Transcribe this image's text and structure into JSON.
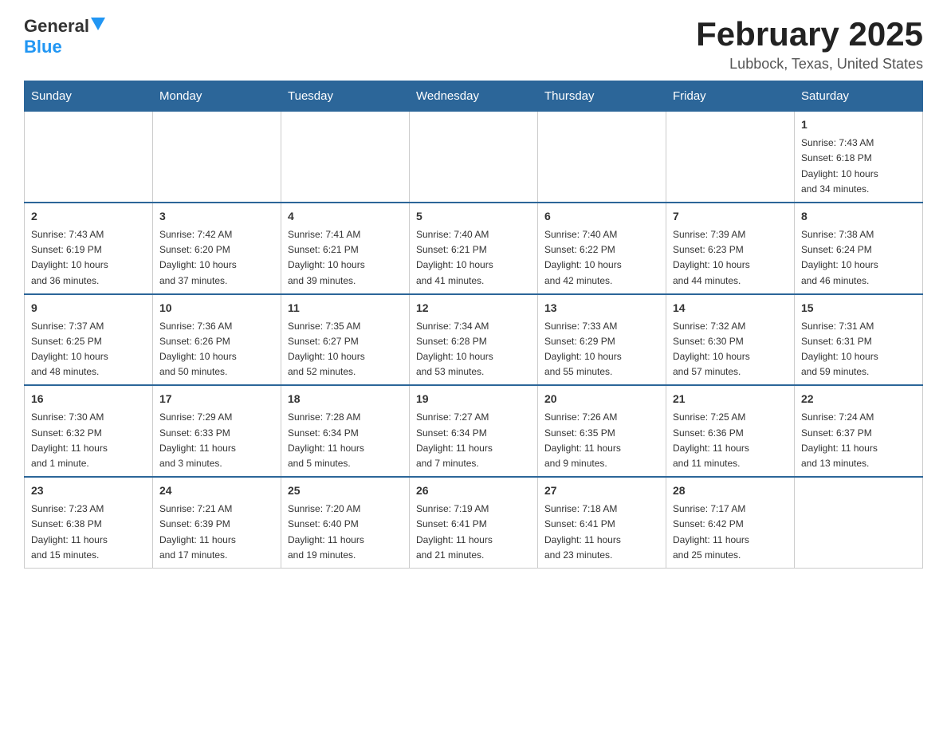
{
  "header": {
    "logo_general": "General",
    "logo_blue": "Blue",
    "title": "February 2025",
    "subtitle": "Lubbock, Texas, United States"
  },
  "days_of_week": [
    "Sunday",
    "Monday",
    "Tuesday",
    "Wednesday",
    "Thursday",
    "Friday",
    "Saturday"
  ],
  "weeks": [
    [
      {
        "day": "",
        "info": ""
      },
      {
        "day": "",
        "info": ""
      },
      {
        "day": "",
        "info": ""
      },
      {
        "day": "",
        "info": ""
      },
      {
        "day": "",
        "info": ""
      },
      {
        "day": "",
        "info": ""
      },
      {
        "day": "1",
        "info": "Sunrise: 7:43 AM\nSunset: 6:18 PM\nDaylight: 10 hours\nand 34 minutes."
      }
    ],
    [
      {
        "day": "2",
        "info": "Sunrise: 7:43 AM\nSunset: 6:19 PM\nDaylight: 10 hours\nand 36 minutes."
      },
      {
        "day": "3",
        "info": "Sunrise: 7:42 AM\nSunset: 6:20 PM\nDaylight: 10 hours\nand 37 minutes."
      },
      {
        "day": "4",
        "info": "Sunrise: 7:41 AM\nSunset: 6:21 PM\nDaylight: 10 hours\nand 39 minutes."
      },
      {
        "day": "5",
        "info": "Sunrise: 7:40 AM\nSunset: 6:21 PM\nDaylight: 10 hours\nand 41 minutes."
      },
      {
        "day": "6",
        "info": "Sunrise: 7:40 AM\nSunset: 6:22 PM\nDaylight: 10 hours\nand 42 minutes."
      },
      {
        "day": "7",
        "info": "Sunrise: 7:39 AM\nSunset: 6:23 PM\nDaylight: 10 hours\nand 44 minutes."
      },
      {
        "day": "8",
        "info": "Sunrise: 7:38 AM\nSunset: 6:24 PM\nDaylight: 10 hours\nand 46 minutes."
      }
    ],
    [
      {
        "day": "9",
        "info": "Sunrise: 7:37 AM\nSunset: 6:25 PM\nDaylight: 10 hours\nand 48 minutes."
      },
      {
        "day": "10",
        "info": "Sunrise: 7:36 AM\nSunset: 6:26 PM\nDaylight: 10 hours\nand 50 minutes."
      },
      {
        "day": "11",
        "info": "Sunrise: 7:35 AM\nSunset: 6:27 PM\nDaylight: 10 hours\nand 52 minutes."
      },
      {
        "day": "12",
        "info": "Sunrise: 7:34 AM\nSunset: 6:28 PM\nDaylight: 10 hours\nand 53 minutes."
      },
      {
        "day": "13",
        "info": "Sunrise: 7:33 AM\nSunset: 6:29 PM\nDaylight: 10 hours\nand 55 minutes."
      },
      {
        "day": "14",
        "info": "Sunrise: 7:32 AM\nSunset: 6:30 PM\nDaylight: 10 hours\nand 57 minutes."
      },
      {
        "day": "15",
        "info": "Sunrise: 7:31 AM\nSunset: 6:31 PM\nDaylight: 10 hours\nand 59 minutes."
      }
    ],
    [
      {
        "day": "16",
        "info": "Sunrise: 7:30 AM\nSunset: 6:32 PM\nDaylight: 11 hours\nand 1 minute."
      },
      {
        "day": "17",
        "info": "Sunrise: 7:29 AM\nSunset: 6:33 PM\nDaylight: 11 hours\nand 3 minutes."
      },
      {
        "day": "18",
        "info": "Sunrise: 7:28 AM\nSunset: 6:34 PM\nDaylight: 11 hours\nand 5 minutes."
      },
      {
        "day": "19",
        "info": "Sunrise: 7:27 AM\nSunset: 6:34 PM\nDaylight: 11 hours\nand 7 minutes."
      },
      {
        "day": "20",
        "info": "Sunrise: 7:26 AM\nSunset: 6:35 PM\nDaylight: 11 hours\nand 9 minutes."
      },
      {
        "day": "21",
        "info": "Sunrise: 7:25 AM\nSunset: 6:36 PM\nDaylight: 11 hours\nand 11 minutes."
      },
      {
        "day": "22",
        "info": "Sunrise: 7:24 AM\nSunset: 6:37 PM\nDaylight: 11 hours\nand 13 minutes."
      }
    ],
    [
      {
        "day": "23",
        "info": "Sunrise: 7:23 AM\nSunset: 6:38 PM\nDaylight: 11 hours\nand 15 minutes."
      },
      {
        "day": "24",
        "info": "Sunrise: 7:21 AM\nSunset: 6:39 PM\nDaylight: 11 hours\nand 17 minutes."
      },
      {
        "day": "25",
        "info": "Sunrise: 7:20 AM\nSunset: 6:40 PM\nDaylight: 11 hours\nand 19 minutes."
      },
      {
        "day": "26",
        "info": "Sunrise: 7:19 AM\nSunset: 6:41 PM\nDaylight: 11 hours\nand 21 minutes."
      },
      {
        "day": "27",
        "info": "Sunrise: 7:18 AM\nSunset: 6:41 PM\nDaylight: 11 hours\nand 23 minutes."
      },
      {
        "day": "28",
        "info": "Sunrise: 7:17 AM\nSunset: 6:42 PM\nDaylight: 11 hours\nand 25 minutes."
      },
      {
        "day": "",
        "info": ""
      }
    ]
  ]
}
